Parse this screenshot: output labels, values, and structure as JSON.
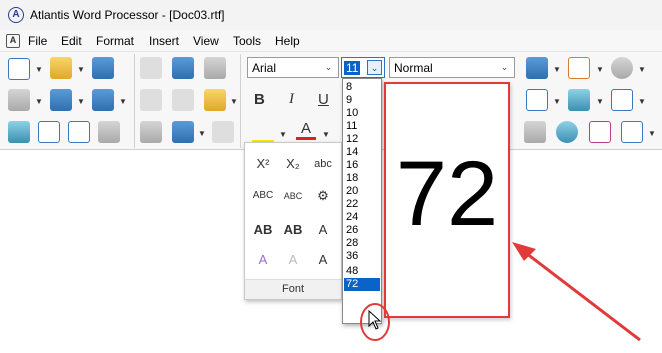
{
  "window": {
    "title": "Atlantis Word Processor - [Doc03.rtf]",
    "logo": "A"
  },
  "menubar": {
    "items": [
      "File",
      "Edit",
      "Format",
      "Insert",
      "View",
      "Tools",
      "Help"
    ]
  },
  "toolbar": {
    "font_name": "Arial",
    "font_size": "11",
    "style": "Normal"
  },
  "font_panel": {
    "caption": "Font",
    "buttons": [
      "B",
      "I",
      "U",
      "X²",
      "X₂",
      "abc",
      "ABC",
      "ABC",
      "A",
      "AB",
      "AB",
      "A",
      "A",
      "A",
      "A"
    ]
  },
  "size_dropdown": {
    "options": [
      "8",
      "9",
      "10",
      "11",
      "12",
      "14",
      "16",
      "18",
      "20",
      "22",
      "24",
      "26",
      "28",
      "36",
      "48",
      "72"
    ],
    "selected": "72"
  },
  "preview": {
    "text": "72"
  },
  "colors": {
    "accent": "#0a64c8",
    "annotation": "#e13a3a"
  }
}
